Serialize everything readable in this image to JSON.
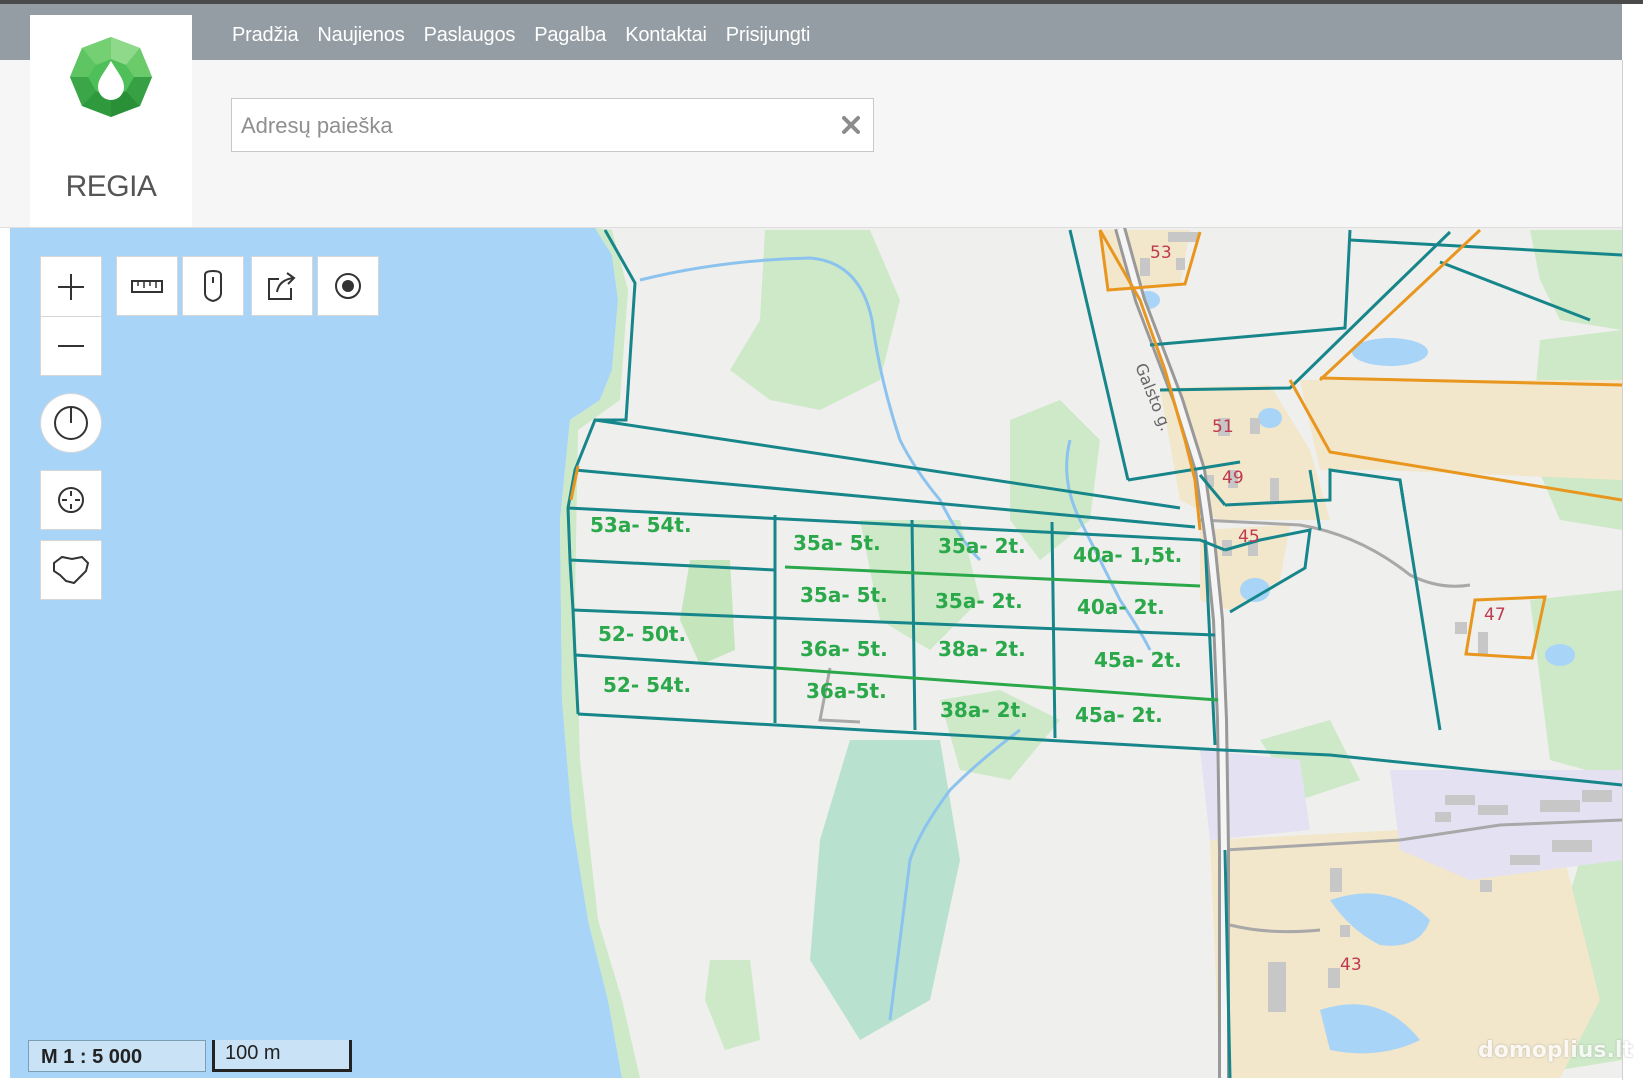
{
  "nav": {
    "items": [
      {
        "label": "Pradžia"
      },
      {
        "label": "Naujienos"
      },
      {
        "label": "Paslaugos"
      },
      {
        "label": "Pagalba"
      },
      {
        "label": "Kontaktai"
      },
      {
        "label": "Prisijungti"
      }
    ]
  },
  "logo": {
    "text": "REGIA"
  },
  "search": {
    "placeholder": "Adresų paieška",
    "value": ""
  },
  "map": {
    "street_name": "Galsto g.",
    "house_numbers": [
      "53",
      "51",
      "49",
      "45",
      "47",
      "43"
    ],
    "plots": [
      {
        "label": "53a- 54t."
      },
      {
        "label": "35a- 5t."
      },
      {
        "label": "35a- 2t."
      },
      {
        "label": "40a- 1,5t."
      },
      {
        "label": "35a- 5t."
      },
      {
        "label": "35a- 2t."
      },
      {
        "label": "40a- 2t."
      },
      {
        "label": "52- 50t."
      },
      {
        "label": "36a- 5t."
      },
      {
        "label": "38a- 2t."
      },
      {
        "label": "45a- 2t."
      },
      {
        "label": "52- 54t."
      },
      {
        "label": "36a-5t."
      },
      {
        "label": "38a- 2t."
      },
      {
        "label": "45a- 2t."
      }
    ],
    "colors": {
      "water": "#a8d4f7",
      "land": "#efefed",
      "forest": "#cde9c8",
      "parcel_border": "#17868a",
      "highlight_border": "#e8961e",
      "plot_label": "#2aa84a"
    }
  },
  "scale": {
    "ratio": "M 1 : 5 000",
    "bar": "100 m"
  },
  "watermark": "domoplius.lt"
}
